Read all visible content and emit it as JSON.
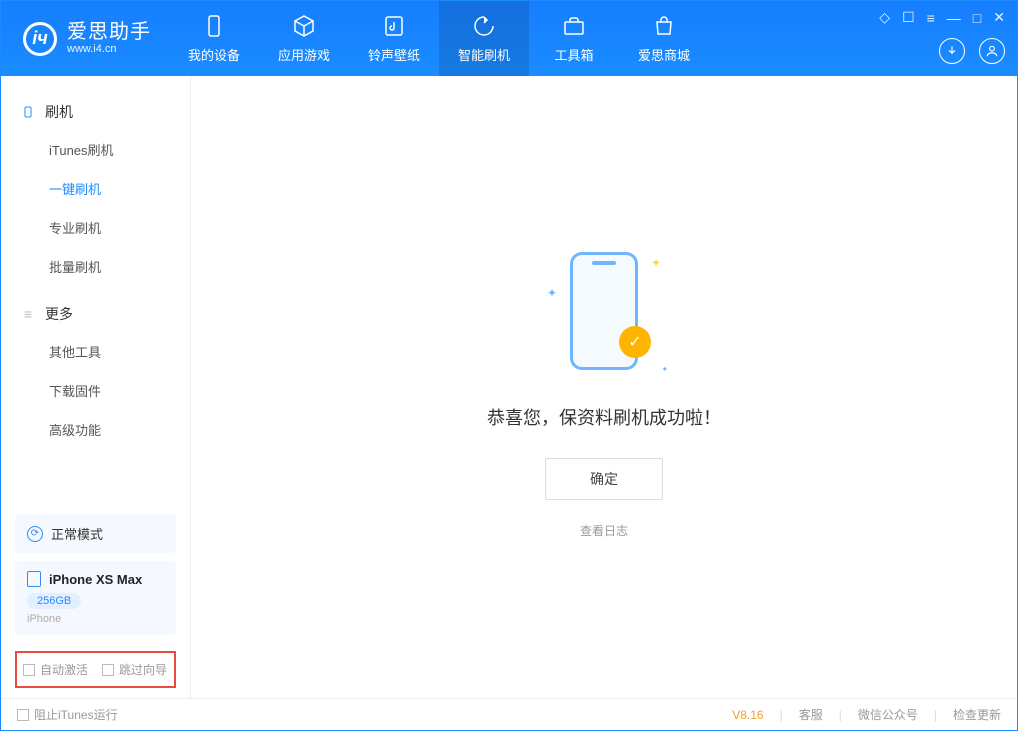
{
  "app": {
    "title": "爱思助手",
    "subtitle": "www.i4.cn"
  },
  "tabs": {
    "device": "我的设备",
    "apps": "应用游戏",
    "ringtone": "铃声壁纸",
    "flash": "智能刷机",
    "tools": "工具箱",
    "store": "爱思商城"
  },
  "sidebar": {
    "group_flash": "刷机",
    "items_flash": {
      "itunes": "iTunes刷机",
      "oneclick": "一键刷机",
      "pro": "专业刷机",
      "batch": "批量刷机"
    },
    "group_more": "更多",
    "items_more": {
      "other": "其他工具",
      "firmware": "下载固件",
      "advanced": "高级功能"
    },
    "mode": "正常模式",
    "device": {
      "name": "iPhone XS Max",
      "capacity": "256GB",
      "type": "iPhone"
    },
    "opt_auto_activate": "自动激活",
    "opt_skip_guide": "跳过向导"
  },
  "main": {
    "success_msg": "恭喜您，保资料刷机成功啦！",
    "ok": "确定",
    "view_log": "查看日志"
  },
  "footer": {
    "block_itunes": "阻止iTunes运行",
    "version": "V8.16",
    "support": "客服",
    "wechat": "微信公众号",
    "update": "检查更新"
  }
}
